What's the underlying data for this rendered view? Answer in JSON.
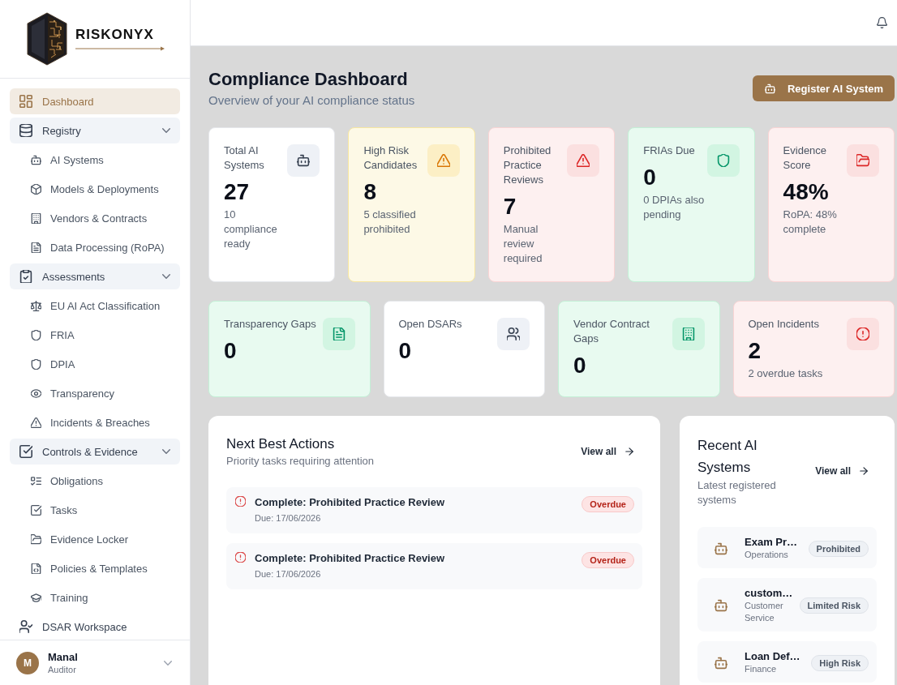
{
  "sidebar": {
    "brand": "RISKONYX",
    "nav": [
      {
        "label": "Dashboard",
        "kind": "link",
        "selected": true
      },
      {
        "label": "Registry",
        "kind": "group",
        "expanded": true,
        "selected": false,
        "children": [
          {
            "label": "AI Systems",
            "selected": false
          },
          {
            "label": "Models & Deployments",
            "selected": false
          },
          {
            "label": "Vendors & Contracts",
            "selected": false
          },
          {
            "label": "Data Processing (RoPA)",
            "selected": false
          }
        ]
      },
      {
        "label": "Assessments",
        "kind": "group",
        "expanded": true,
        "selected": false,
        "children": [
          {
            "label": "EU AI Act Classification",
            "selected": false
          },
          {
            "label": "FRIA",
            "selected": false
          },
          {
            "label": "DPIA",
            "selected": false
          },
          {
            "label": "Transparency",
            "selected": false
          },
          {
            "label": "Incidents & Breaches",
            "selected": false
          }
        ]
      },
      {
        "label": "Controls & Evidence",
        "kind": "group",
        "expanded": true,
        "selected": false,
        "children": [
          {
            "label": "Obligations",
            "selected": false
          },
          {
            "label": "Tasks",
            "selected": false
          },
          {
            "label": "Evidence Locker",
            "selected": false
          },
          {
            "label": "Policies & Templates",
            "selected": false
          },
          {
            "label": "Training",
            "selected": false
          }
        ]
      },
      {
        "label": "DSAR Workspace",
        "kind": "link",
        "selected": false
      }
    ],
    "user": {
      "initial": "M",
      "name": "Manal",
      "role": "Auditor"
    }
  },
  "header": {
    "title": "Compliance Dashboard",
    "subtitle": "Overview of your AI compliance status",
    "action": "Register AI System"
  },
  "stat_rows": [
    {
      "cards": [
        {
          "label": "Total AI Systems",
          "value": "27",
          "note": "10 compliance ready",
          "kind": "neutral"
        },
        {
          "label": "High Risk Candidates",
          "value": "8",
          "note": "5 classified prohibited",
          "kind": "warning"
        },
        {
          "label": "Prohibited Practice Reviews",
          "value": "7",
          "note": "Manual review required",
          "kind": "danger"
        },
        {
          "label": "FRIAs Due",
          "value": "0",
          "note": "0 DPIAs also pending",
          "kind": "success"
        },
        {
          "label": "Evidence Score",
          "value": "48%",
          "note": "RoPA: 48% complete",
          "kind": "danger"
        }
      ]
    },
    {
      "cards": [
        {
          "label": "Transparency Gaps",
          "value": "0",
          "kind": "success"
        },
        {
          "label": "Open DSARs",
          "value": "0",
          "kind": "neutral"
        },
        {
          "label": "Vendor Contract Gaps",
          "value": "0",
          "kind": "success"
        },
        {
          "label": "Open Incidents",
          "value": "2",
          "note": "2 overdue tasks",
          "kind": "danger"
        }
      ]
    }
  ],
  "next_best_actions": {
    "title": "Next Best Actions",
    "subtitle": "Priority tasks requiring attention",
    "link": "View all",
    "items": [
      {
        "title": "Complete: Prohibited Practice Review",
        "due": "Due: 17/06/2026",
        "badge": "Overdue"
      },
      {
        "title": "Complete: Prohibited Practice Review",
        "due": "Due: 17/06/2026",
        "badge": "Overdue"
      }
    ]
  },
  "recent_ai_systems": {
    "title": "Recent AI Systems",
    "subtitle": "Latest registered systems",
    "link": "View all",
    "items": [
      {
        "name": "Exam Pr…",
        "department": "Operations",
        "risk": "Prohibited"
      },
      {
        "name": "custom…",
        "department": "Customer Service",
        "risk": "Limited Risk"
      },
      {
        "name": "Loan Def…",
        "department": "Finance",
        "risk": "High Risk"
      }
    ]
  }
}
